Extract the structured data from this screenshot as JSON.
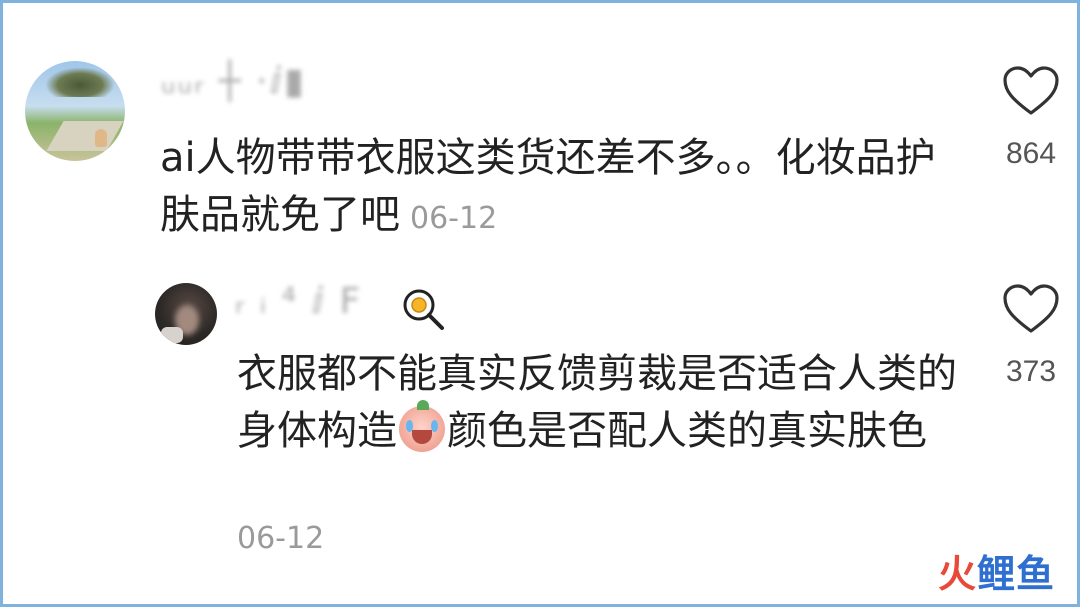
{
  "comments": [
    {
      "author_masked": "ᵤᵤᵣ ┼ ·ⅈ▮",
      "text": "ai人物带带衣服这类货还差不多。。化妆品护肤品就免了吧",
      "date": "06-12",
      "likes": "864"
    },
    {
      "author_masked": "ᵣ ᵢ ⁴ ⅈ F",
      "text_a": "衣服都不能真实反馈剪裁是否适合人类的身体构造",
      "text_b": "颜色是否配人类的真实肤色",
      "date": "06-12",
      "likes": "373",
      "emoji": "crying-face-emoji",
      "name_emoji": "fried-egg-emoji"
    }
  ],
  "watermark": {
    "part1": "火",
    "part2": "鲤鱼"
  },
  "colors": {
    "frame_border": "#7fb2dc",
    "text": "#222222",
    "muted": "#9a9a9a"
  }
}
